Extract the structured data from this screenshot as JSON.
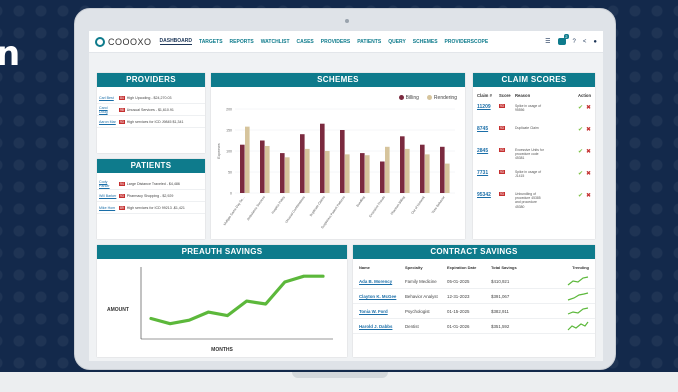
{
  "background_text": "n",
  "app": {
    "logo_text": "COOOXO"
  },
  "nav": {
    "items": [
      "DASHBOARD",
      "TARGETS",
      "REPORTS",
      "WATCHLIST",
      "CASES",
      "PROVIDERS",
      "PATIENTS",
      "QUERY",
      "SCHEMES",
      "PROVIDERSCOPE"
    ],
    "active": "DASHBOARD",
    "notification_count": "2",
    "icons": [
      "list-icon",
      "bell-icon",
      "help-icon",
      "share-icon",
      "user-icon"
    ]
  },
  "providers": {
    "title": "PROVIDERS",
    "rows": [
      {
        "name": "Carl Best",
        "score": "84",
        "desc": "High Upcoding - $24,270.03"
      },
      {
        "name": "Carol Doug",
        "score": "98",
        "desc": "Unusual Services - $1,610.91"
      },
      {
        "name": "Aaron Mar",
        "score": "93",
        "desc": "High services for ICD J9845 $1,341"
      }
    ]
  },
  "patients": {
    "title": "PATIENTS",
    "rows": [
      {
        "name": "Cody Parker",
        "score": "94",
        "desc": "Large Distance Traveled - $4,486"
      },
      {
        "name": "Will Barker",
        "score": "93",
        "desc": "Pharmacy Shopping - $2,929"
      },
      {
        "name": "Mike Hom",
        "score": "89",
        "desc": "High services for ICD 99213 -$1,421"
      }
    ]
  },
  "schemes": {
    "title": "SCHEMES"
  },
  "claim_scores": {
    "title": "CLAIM SCORES",
    "headers": [
      "Claim #",
      "Score",
      "Reason",
      "Action"
    ],
    "rows": [
      {
        "claim": "11209",
        "score": "93",
        "reason": "Spike in usage of 95556"
      },
      {
        "claim": "8745",
        "score": "93",
        "reason": "Duplicate Claim"
      },
      {
        "claim": "2845",
        "score": "93",
        "reason": "Excessive Units for procedure code 45381"
      },
      {
        "claim": "7731",
        "score": "93",
        "reason": "Spike in usage of J1415"
      },
      {
        "claim": "95342",
        "score": "93",
        "reason": "Unbundling of procedure 45385 and procedure 45380"
      }
    ]
  },
  "preauth": {
    "title": "PREAUTH SAVINGS",
    "ylabel": "AMOUNT",
    "xlabel": "MONTHS"
  },
  "contract": {
    "title": "CONTRACT SAVINGS",
    "headers": [
      "Name",
      "Specialty",
      "Expiration Date",
      "Total Savings",
      "Trending"
    ],
    "rows": [
      {
        "name": "Ada B. Morency",
        "specialty": "Family Medicine",
        "date": "05-01-2025",
        "savings": "$410,921"
      },
      {
        "name": "Clayton K. McGee",
        "specialty": "Behavior Analyst",
        "date": "12-31-2023",
        "savings": "$391,067"
      },
      {
        "name": "Tonia W. Ford",
        "specialty": "Psychologist",
        "date": "01-15-2025",
        "savings": "$382,911"
      },
      {
        "name": "Harold J. Dabbs",
        "specialty": "Dentist",
        "date": "01-01-2026",
        "savings": "$351,592"
      }
    ]
  },
  "chart_data": [
    {
      "type": "bar",
      "title": "",
      "categories": [
        "Multiple Same-Day Se…",
        "Ambulance Services",
        "Hospice Policy",
        "Unusual Combinations",
        "Duplicate Claims",
        "Suspicious Patient Patterns",
        "Bundling",
        "Excessive Frauds",
        "Phantom Billing",
        "Out of Network",
        "Time Behavior"
      ],
      "series": [
        {
          "name": "Billing",
          "color": "#7b2a3f",
          "values": [
            115,
            125,
            95,
            140,
            165,
            150,
            95,
            75,
            135,
            115,
            110
          ]
        },
        {
          "name": "Rendering",
          "color": "#d6c49c",
          "values": [
            158,
            112,
            85,
            105,
            100,
            92,
            90,
            110,
            105,
            92,
            70
          ]
        }
      ],
      "ylabel": "Expenses",
      "ylim": [
        0,
        200
      ],
      "yticks": [
        "0",
        "50",
        "100",
        "150",
        "200"
      ],
      "legend": "top-right"
    },
    {
      "type": "line",
      "title": "PREAUTH SAVINGS",
      "xlabel": "MONTHS",
      "ylabel": "AMOUNT",
      "series": [
        {
          "name": "",
          "color": "#5cb83b",
          "values": [
            0.25,
            0.16,
            0.22,
            0.36,
            0.3,
            0.55,
            0.5,
            0.88,
            0.98,
            0.98
          ]
        }
      ]
    }
  ]
}
